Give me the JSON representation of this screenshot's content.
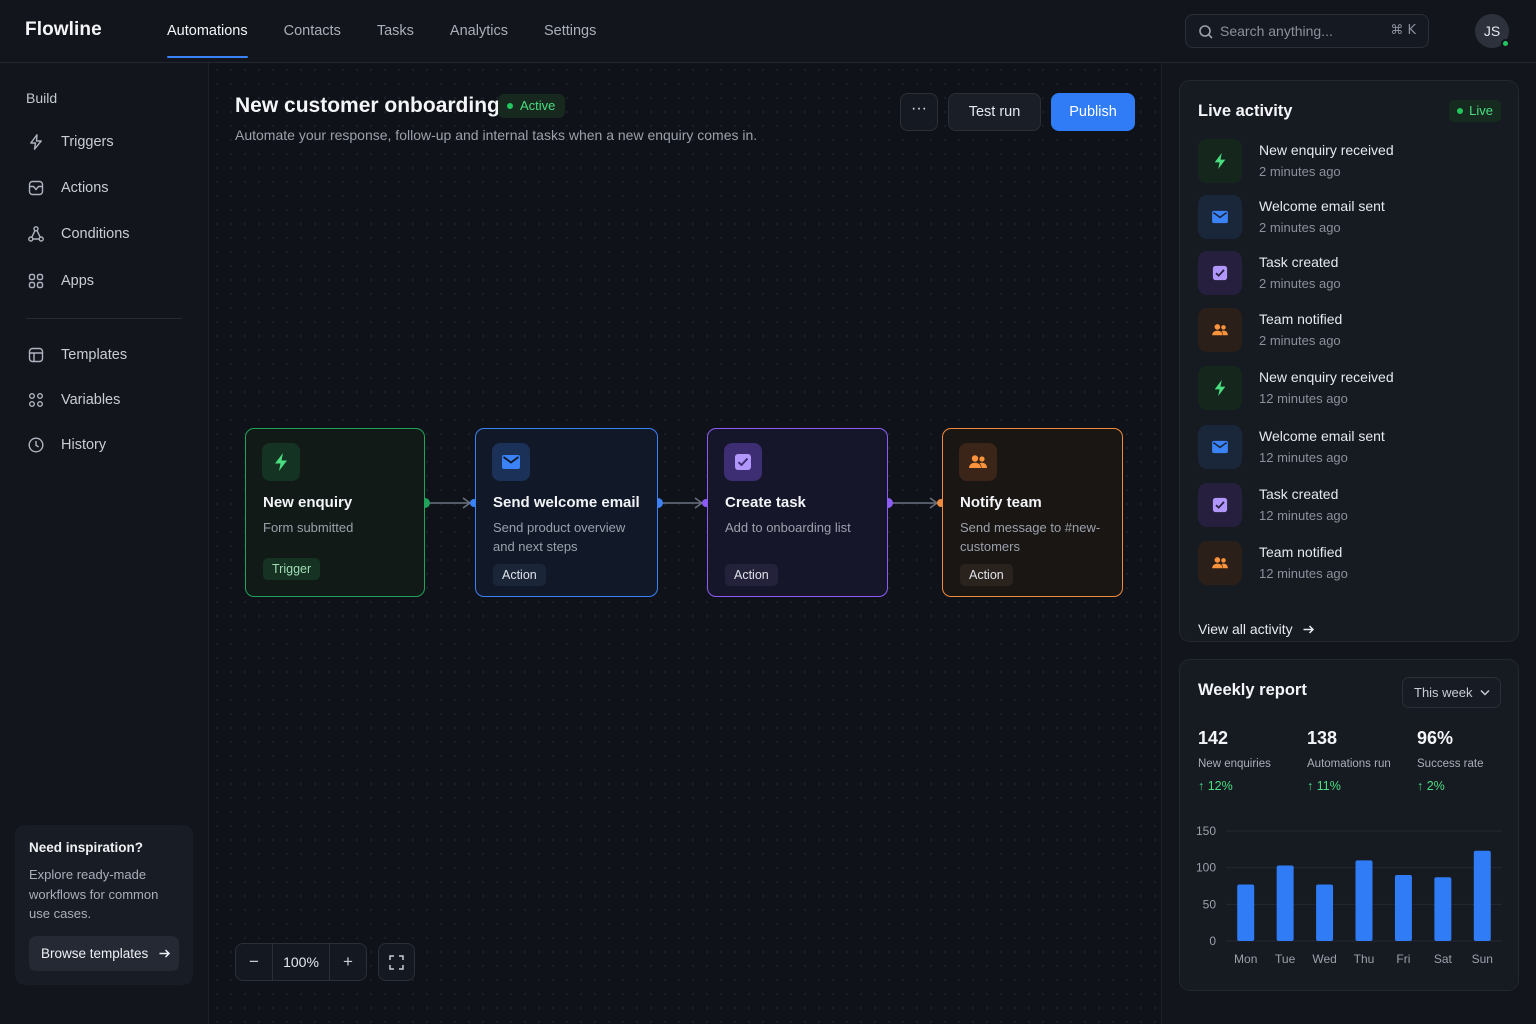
{
  "app": {
    "name": "Flowline"
  },
  "nav": {
    "tabs": [
      {
        "label": "Automations",
        "active": true
      },
      {
        "label": "Contacts"
      },
      {
        "label": "Tasks"
      },
      {
        "label": "Analytics"
      },
      {
        "label": "Settings"
      }
    ],
    "search_placeholder": "Search anything...",
    "search_shortcut": "⌘ K",
    "user_initials": "JS",
    "user_online": true
  },
  "sidebar": {
    "section": "Build",
    "items": [
      {
        "label": "Triggers",
        "icon": "lightning-icon"
      },
      {
        "label": "Actions",
        "icon": "box-icon"
      },
      {
        "label": "Conditions",
        "icon": "branch-icon"
      },
      {
        "label": "Apps",
        "icon": "grid-icon"
      },
      {
        "label": "Templates",
        "icon": "template-icon"
      },
      {
        "label": "Variables",
        "icon": "variables-icon"
      },
      {
        "label": "History",
        "icon": "clock-icon"
      }
    ],
    "inspiration": {
      "title": "Need inspiration?",
      "text": "Explore ready-made workflows for common use cases.",
      "button": "Browse templates"
    }
  },
  "workflow": {
    "title": "New customer onboarding",
    "status": "Active",
    "description": "Automate your response, follow-up and internal tasks when a new enquiry comes in.",
    "more_label": "···",
    "test_run_label": "Test run",
    "publish_label": "Publish",
    "nodes": [
      {
        "title": "New enquiry",
        "subtitle": "Form submitted",
        "tag": "Trigger",
        "icon": "lightning-icon",
        "color": "#22a35a"
      },
      {
        "title": "Send welcome email",
        "subtitle": "Send product overview and next steps",
        "tag": "Action",
        "icon": "mail-icon",
        "color": "#3b82f6"
      },
      {
        "title": "Create task",
        "subtitle": "Add to onboarding list",
        "tag": "Action",
        "icon": "checkbox-icon",
        "color": "#8b5cf6"
      },
      {
        "title": "Notify team",
        "subtitle": "Send message to #new-customers",
        "tag": "Action",
        "icon": "users-icon",
        "color": "#f08a3c"
      }
    ],
    "zoom": {
      "minus": "−",
      "level": "100%",
      "plus": "+"
    }
  },
  "activity": {
    "title": "Live activity",
    "live_label": "Live",
    "items": [
      {
        "title": "New enquiry received",
        "time": "2 minutes ago",
        "icon": "lightning-icon",
        "tone": "green"
      },
      {
        "title": "Welcome email sent",
        "time": "2 minutes ago",
        "icon": "mail-icon",
        "tone": "blue"
      },
      {
        "title": "Task created",
        "time": "2 minutes ago",
        "icon": "checkbox-icon",
        "tone": "purple"
      },
      {
        "title": "Team notified",
        "time": "2 minutes ago",
        "icon": "users-icon",
        "tone": "orange"
      },
      {
        "title": "New enquiry received",
        "time": "12 minutes ago",
        "icon": "lightning-icon",
        "tone": "green"
      },
      {
        "title": "Welcome email sent",
        "time": "12 minutes ago",
        "icon": "mail-icon",
        "tone": "blue"
      },
      {
        "title": "Task created",
        "time": "12 minutes ago",
        "icon": "checkbox-icon",
        "tone": "purple"
      },
      {
        "title": "Team notified",
        "time": "12 minutes ago",
        "icon": "users-icon",
        "tone": "orange"
      }
    ],
    "view_all": "View all activity"
  },
  "report": {
    "title": "Weekly report",
    "period": "This week",
    "stats": [
      {
        "value": "142",
        "label": "New enquiries",
        "delta": "12%"
      },
      {
        "value": "138",
        "label": "Automations run",
        "delta": "11%"
      },
      {
        "value": "96%",
        "label": "Success rate",
        "delta": "2%"
      }
    ]
  },
  "chart_data": {
    "type": "bar",
    "categories": [
      "Mon",
      "Tue",
      "Wed",
      "Thu",
      "Fri",
      "Sat",
      "Sun"
    ],
    "values": [
      77,
      103,
      77,
      110,
      90,
      87,
      123
    ],
    "yticks": [
      0,
      50,
      100,
      150
    ],
    "ylim": [
      0,
      150
    ],
    "color": "#2f7cf6",
    "grid": true
  }
}
